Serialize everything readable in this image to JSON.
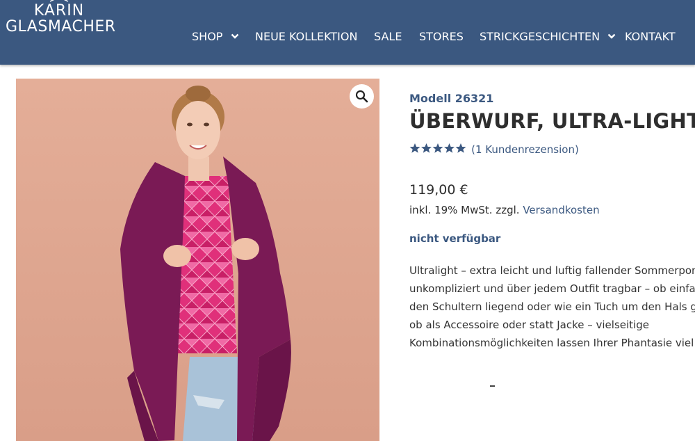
{
  "brand": {
    "line1": "KARIN",
    "line2": "GLASMACHER"
  },
  "nav": {
    "items": [
      {
        "label": "SHOP",
        "has_dropdown": true
      },
      {
        "label": "NEUE KOLLEKTION",
        "has_dropdown": false
      },
      {
        "label": "SALE",
        "has_dropdown": false
      },
      {
        "label": "STORES",
        "has_dropdown": false
      },
      {
        "label": "STRICKGESCHICHTEN",
        "has_dropdown": true
      },
      {
        "label": "KONTAKT",
        "has_dropdown": false
      }
    ]
  },
  "product": {
    "model": "Modell 26321",
    "title": "ÜBERWURF, ULTRA-LIGHT",
    "rating": {
      "stars": 5,
      "max": 5,
      "review_link": "(1 Kundenrezension)"
    },
    "price": "119,00 €",
    "tax_note": "inkl. 19% MwSt. zzgl.",
    "shipping_link": "Versandkosten",
    "availability": "nicht verfügbar",
    "description_lines": [
      "Ultralight – extra leicht und luftig fallender Sommerponcho,",
      "unkompliziert und über jedem Outfit tragbar – ob einfach auf",
      "den Schultern liegend oder wie ein Tuch um den Hals gelegt,",
      "ob als Accessoire oder statt Jacke – vielseitige",
      "Kombinationsmöglichkeiten lassen Ihrer Phantasie viel Raum."
    ]
  },
  "icons": {
    "zoom": "magnifier-icon",
    "star": "star-icon",
    "chevron": "chevron-down-icon"
  },
  "colors": {
    "header_bg": "#3b5880",
    "accent": "#3b5880",
    "text": "#2e2e2e",
    "image_bg": "#e0a994",
    "garment": "#7a1a55"
  }
}
